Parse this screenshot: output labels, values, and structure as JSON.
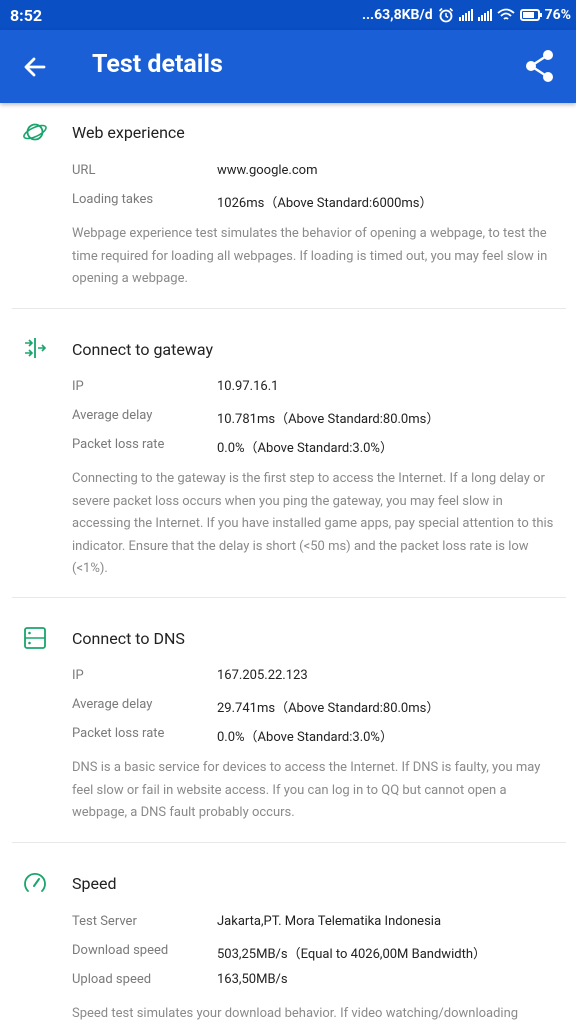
{
  "status_bar": {
    "time": "8:52",
    "net_speed": "...63,8KB/d",
    "battery_level": "76%",
    "battery_fraction": 0.76
  },
  "app_bar": {
    "title": "Test details",
    "back_icon": "arrow-left-icon",
    "share_icon": "share-icon"
  },
  "colors": {
    "status_bar": "#0b4fc5",
    "app_bar": "#1b5fd6",
    "accent_icon": "#1aa56c",
    "label": "#7a7a7a",
    "value": "#222222",
    "description": "#8a8a8a"
  },
  "sections": [
    {
      "title": "Web experience",
      "icon": "planet-icon",
      "rows": [
        {
          "label": "URL",
          "value": "www.google.com"
        },
        {
          "label": "Loading takes",
          "value": "1026ms（Above Standard:6000ms）"
        }
      ],
      "description": "Webpage experience test simulates the behavior of opening a webpage, to test the time required for loading all webpages. If loading is timed out, you may feel slow in opening a webpage."
    },
    {
      "title": "Connect to gateway",
      "icon": "gateway-icon",
      "rows": [
        {
          "label": "IP",
          "value": "10.97.16.1"
        },
        {
          "label": "Average delay",
          "value": "10.781ms（Above Standard:80.0ms）"
        },
        {
          "label": "Packet loss rate",
          "value": "0.0%（Above Standard:3.0%）"
        }
      ],
      "description": "Connecting to the gateway is the first step to access the Internet. If a long delay or severe packet loss occurs when you ping the gateway, you may feel slow in accessing the Internet. If you have installed game apps, pay special attention to this indicator. Ensure that the delay is short (<50 ms) and the packet loss rate is low (<1%)."
    },
    {
      "title": "Connect to DNS",
      "icon": "server-icon",
      "rows": [
        {
          "label": "IP",
          "value": "167.205.22.123"
        },
        {
          "label": "Average delay",
          "value": "29.741ms（Above Standard:80.0ms）"
        },
        {
          "label": "Packet loss rate",
          "value": "0.0%（Above Standard:3.0%）"
        }
      ],
      "description": "DNS is a basic service for devices to access the Internet. If DNS is faulty, you may feel slow or fail in website access. If you can log in to QQ but cannot open a webpage, a DNS fault probably occurs."
    },
    {
      "title": "Speed",
      "icon": "speedometer-icon",
      "rows": [
        {
          "label": "Test Server",
          "value": "Jakarta,PT. Mora Telematika Indonesia"
        },
        {
          "label": "Download speed",
          "value": "503,25MB/s（Equal to 4026,00M Bandwidth）"
        },
        {
          "label": "Upload speed",
          "value": "163,50MB/s"
        }
      ],
      "description": "Speed test simulates your download behavior. If video watching/downloading"
    }
  ]
}
